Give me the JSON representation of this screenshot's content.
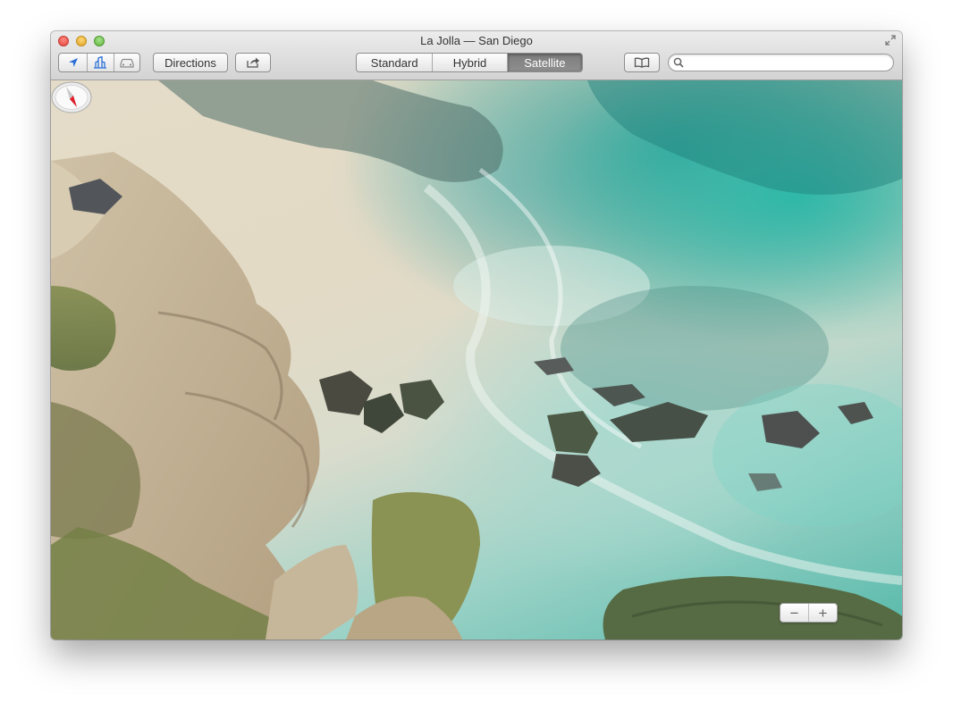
{
  "window": {
    "title": "La Jolla — San Diego"
  },
  "toolbar": {
    "location_button": "location-arrow-icon",
    "three_d_button": "3d-buildings-icon",
    "traffic_button": "car-traffic-icon",
    "directions_label": "Directions",
    "share_button": "share-icon",
    "map_modes": [
      {
        "label": "Standard",
        "active": false
      },
      {
        "label": "Hybrid",
        "active": false
      },
      {
        "label": "Satellite",
        "active": true
      }
    ],
    "bookmarks_button": "book-icon",
    "search": {
      "value": "",
      "placeholder": ""
    }
  },
  "map_controls": {
    "zoom_out_label": "−",
    "zoom_in_label": "+",
    "compass": "compass-icon"
  },
  "colors": {
    "active_segment": "#858585",
    "accent": "#2a6fd6",
    "compass_red": "#e0202a"
  }
}
